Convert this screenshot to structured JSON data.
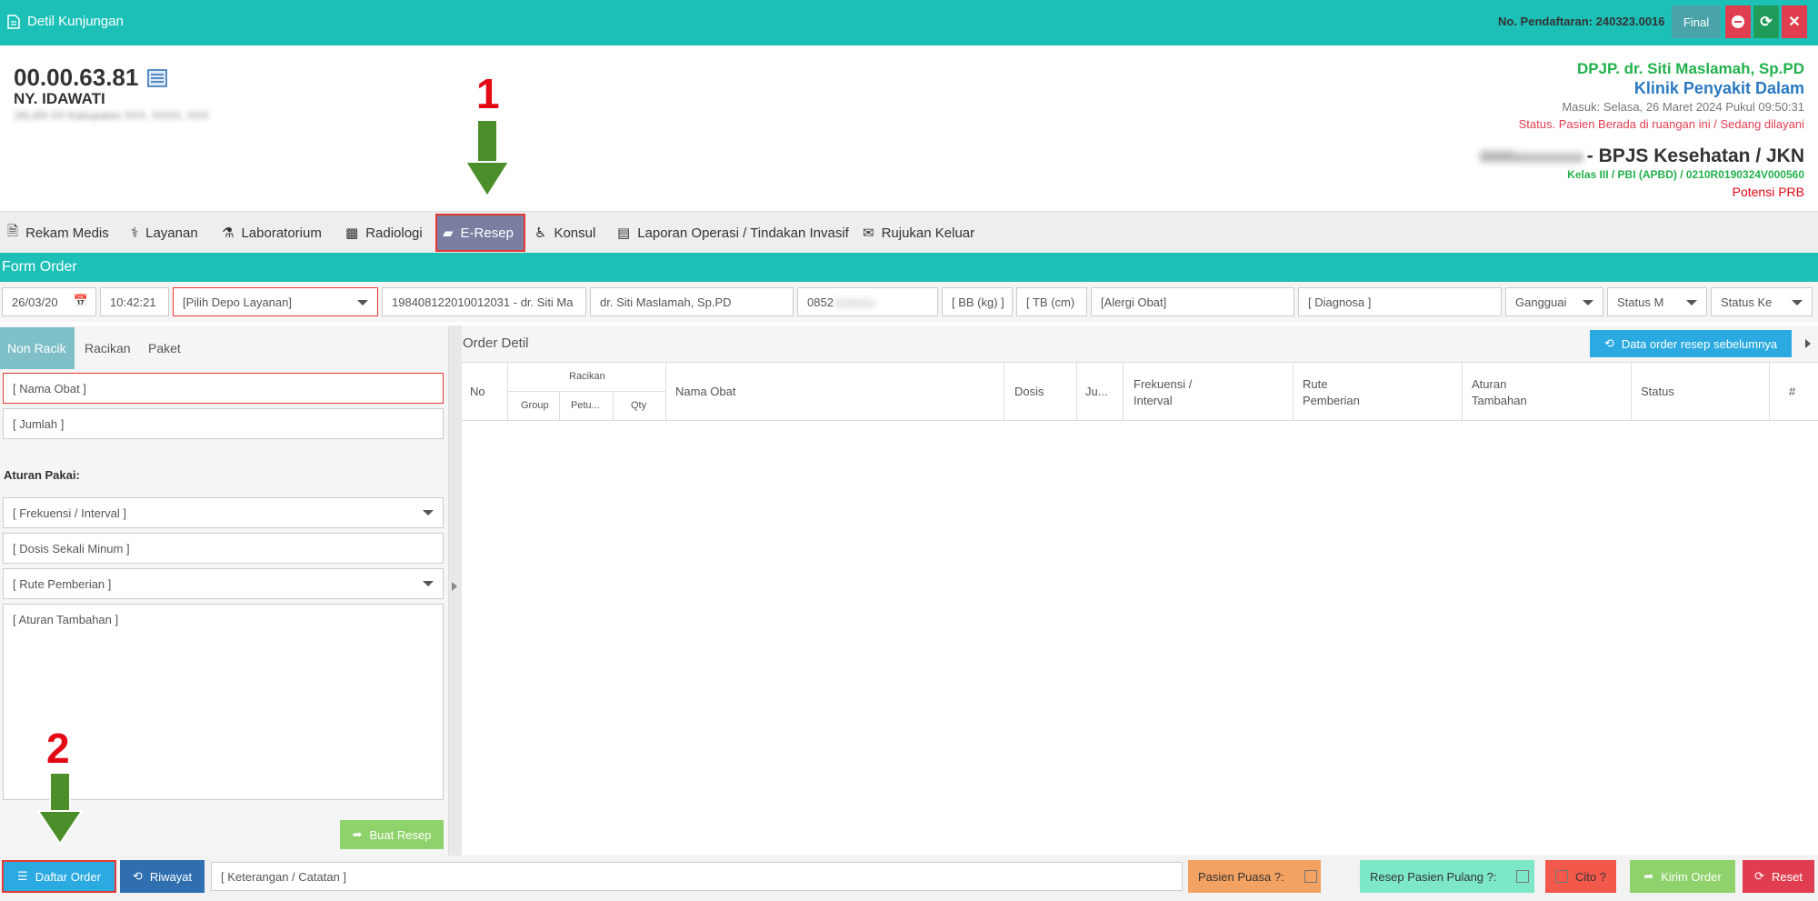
{
  "topbar": {
    "title": "Detil Kunjungan",
    "registration": "No. Pendaftaran: 240323.0016",
    "final_label": "Final"
  },
  "patient": {
    "id": "00.00.63.81",
    "name": "NY. IDAWATI",
    "address": "JALAN XX Kabupaten XXX, XXXX, XXX"
  },
  "visit": {
    "dpjp": "DPJP. dr. Siti Maslamah, Sp.PD",
    "clinic": "Klinik Penyakit Dalam",
    "masuk": "Masuk: Selasa, 26 Maret 2024 Pukul 09:50:31",
    "status": "Status. Pasien Berada di ruangan ini / Sedang dilayani",
    "card_blur": "0000xxxxxxxx",
    "insurance": "- BPJS Kesehatan / JKN",
    "kelas": "Kelas III / PBI (APBD) / 0210R0190324V000560",
    "potensi": "Potensi PRB"
  },
  "tabs": [
    {
      "label": "Rekam Medis",
      "icon": "document-icon"
    },
    {
      "label": "Layanan",
      "icon": "doctor-icon"
    },
    {
      "label": "Laboratorium",
      "icon": "flask-icon"
    },
    {
      "label": "Radiologi",
      "icon": "xray-icon"
    },
    {
      "label": "E-Resep",
      "icon": "eraser-icon",
      "active": true
    },
    {
      "label": "Konsul",
      "icon": "wheelchair-icon"
    },
    {
      "label": "Laporan Operasi / Tindakan Invasif",
      "icon": "newspaper-icon"
    },
    {
      "label": "Rujukan Keluar",
      "icon": "envelope-icon"
    }
  ],
  "form": {
    "title": "Form Order",
    "date": "26/03/20",
    "time": "10:42:21",
    "depo_placeholder": "[Pilih Depo Layanan]",
    "doctor_nip": "198408122010012031 - dr. Siti Ma",
    "doctor_name": "dr. Siti Maslamah, Sp.PD",
    "phone": "0852",
    "bb": "[ BB (kg) ]",
    "tb": "[ TB (cm)",
    "alergi": "[Alergi Obat]",
    "diagnosa": "[ Diagnosa ]",
    "gangguan": "Gangguai",
    "status_m": "Status M",
    "status_k": "Status Ke"
  },
  "left": {
    "tabs": [
      "Non Racik",
      "Racikan",
      "Paket"
    ],
    "nama_obat": "[ Nama Obat ]",
    "jumlah": "[ Jumlah ]",
    "aturan_pakai": "Aturan Pakai:",
    "frekuensi": "[ Frekuensi / Interval ]",
    "dosis": "[ Dosis Sekali Minum ]",
    "rute": "[ Rute Pemberian ]",
    "aturan_tambahan": "[ Aturan Tambahan ]",
    "buat_resep": "Buat Resep"
  },
  "order": {
    "title": "Order Detil",
    "prev_button": "Data order resep sebelumnya",
    "headers": {
      "no": "No",
      "racikan": "Racikan",
      "group": "Group",
      "petunjuk": "Petu...",
      "qty": "Qty",
      "nama_obat": "Nama Obat",
      "dosis": "Dosis",
      "jumlah": "Ju...",
      "frekuensi_1": "Frekuensi /",
      "frekuensi_2": "Interval",
      "rute_1": "Rute",
      "rute_2": "Pemberian",
      "aturan_1": "Aturan",
      "aturan_2": "Tambahan",
      "status": "Status",
      "hash": "#"
    }
  },
  "bottom": {
    "daftar_order": "Daftar Order",
    "riwayat": "Riwayat",
    "keterangan": "[ Keterangan / Catatan ]",
    "puasa": "Pasien Puasa ?:",
    "pulang": "Resep Pasien Pulang ?:",
    "cito": "Cito ?",
    "kirim": "Kirim Order",
    "reset": "Reset"
  },
  "annotations": {
    "one": "1",
    "two": "2"
  }
}
